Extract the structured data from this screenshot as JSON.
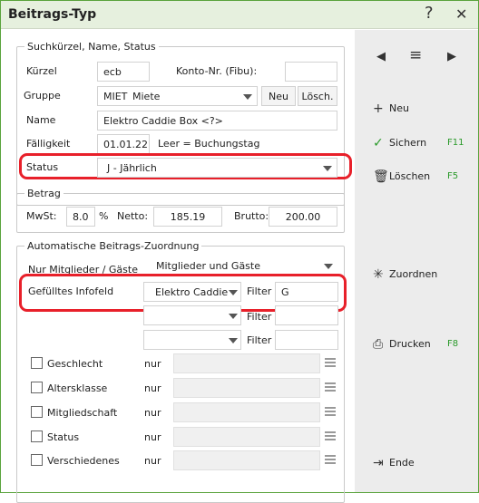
{
  "window": {
    "title": "Beitrags-Typ",
    "help_glyph": "?",
    "close_glyph": "✕"
  },
  "section1": {
    "legend": "Suchkürzel, Name, Status",
    "kuerzel_label": "Kürzel",
    "kuerzel_value": "ecb",
    "konto_label": "Konto-Nr. (Fibu):",
    "konto_value": "",
    "gruppe_label": "Gruppe",
    "gruppe_code": "MIET",
    "gruppe_name": "Miete",
    "neu_label": "Neu",
    "loesch_label": "Lösch.",
    "name_label": "Name",
    "name_value": "Elektro Caddie Box <?>",
    "faelligkeit_label": "Fälligkeit",
    "faelligkeit_value": "01.01.22",
    "faelligkeit_hint": "Leer = Buchungstag",
    "status_label": "Status",
    "status_value": "J - Jährlich"
  },
  "betrag": {
    "legend": "Betrag",
    "mwst_label": "MwSt:",
    "mwst_value": "8.0",
    "percent": "%",
    "netto_label": "Netto:",
    "netto_value": "185.19",
    "brutto_label": "Brutto:",
    "brutto_value": "200.00"
  },
  "zuordnung": {
    "legend": "Automatische Beitrags-Zuordnung",
    "nur_label": "Nur Mitglieder / Gäste",
    "nur_value": "Mitglieder und Gäste",
    "infofeld_label": "Gefülltes Infofeld",
    "filters": [
      {
        "field": "Elektro Caddie",
        "filter_label": "Filter",
        "filter_value": "G"
      },
      {
        "field": "",
        "filter_label": "Filter",
        "filter_value": ""
      },
      {
        "field": "",
        "filter_label": "Filter",
        "filter_value": ""
      }
    ],
    "checks": [
      {
        "label": "Geschlecht",
        "nur": "nur"
      },
      {
        "label": "Altersklasse",
        "nur": "nur"
      },
      {
        "label": "Mitgliedschaft",
        "nur": "nur"
      },
      {
        "label": "Status",
        "nur": "nur"
      },
      {
        "label": "Verschiedenes",
        "nur": "nur"
      }
    ]
  },
  "sidebar": {
    "nav_prev": "◀",
    "nav_menu": "≡",
    "nav_next": "▶",
    "neu": "Neu",
    "sichern": "Sichern",
    "sichern_key": "F11",
    "loeschen": "Löschen",
    "loeschen_key": "F5",
    "zuordnen": "Zuordnen",
    "drucken": "Drucken",
    "drucken_key": "F8",
    "ende": "Ende"
  },
  "colors": {
    "highlight": "#e8202a",
    "shortcut": "#2a9a2a",
    "titlebar": "#e6f0de"
  }
}
